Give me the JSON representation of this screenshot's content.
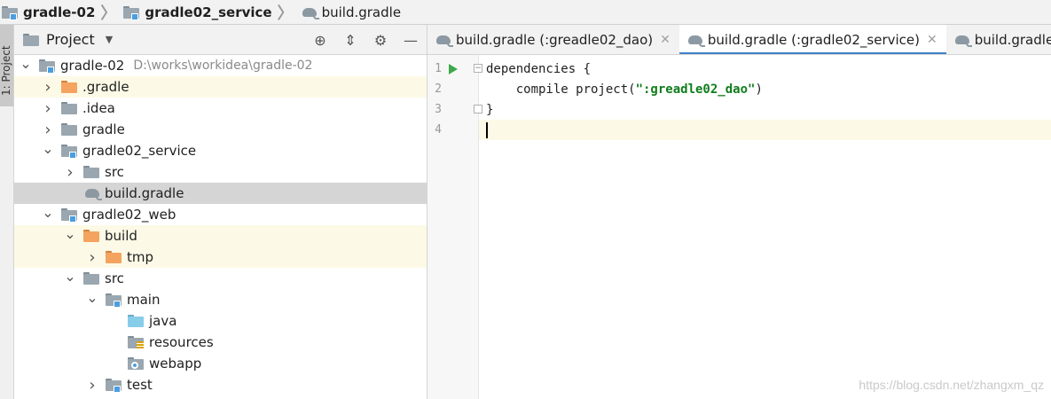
{
  "breadcrumb": {
    "items": [
      {
        "label": "gradle-02",
        "icon": "module-folder-icon",
        "bold": true
      },
      {
        "label": "gradle02_service",
        "icon": "module-folder-icon",
        "bold": true
      },
      {
        "label": "build.gradle",
        "icon": "gradle-elephant-icon",
        "bold": false
      }
    ]
  },
  "left_strip": {
    "tab_label": "1: Project"
  },
  "project_panel": {
    "title": "Project",
    "tools": [
      "locate-icon",
      "collapse-icon",
      "gear-icon",
      "minimize-icon"
    ],
    "tree": [
      {
        "label": "gradle-02",
        "hint": "D:\\works\\workidea\\gradle-02",
        "depth": 0,
        "arrow": "down",
        "icon": "module",
        "state": ""
      },
      {
        "label": ".gradle",
        "hint": "",
        "depth": 1,
        "arrow": "right",
        "icon": "orange",
        "state": "hl"
      },
      {
        "label": ".idea",
        "hint": "",
        "depth": 1,
        "arrow": "right",
        "icon": "gray",
        "state": ""
      },
      {
        "label": "gradle",
        "hint": "",
        "depth": 1,
        "arrow": "right",
        "icon": "gray",
        "state": ""
      },
      {
        "label": "gradle02_service",
        "hint": "",
        "depth": 1,
        "arrow": "down",
        "icon": "module",
        "state": ""
      },
      {
        "label": "src",
        "hint": "",
        "depth": 2,
        "arrow": "right",
        "icon": "gray",
        "state": ""
      },
      {
        "label": "build.gradle",
        "hint": "",
        "depth": 2,
        "arrow": "none",
        "icon": "elephant",
        "state": "sel"
      },
      {
        "label": "gradle02_web",
        "hint": "",
        "depth": 1,
        "arrow": "down",
        "icon": "module",
        "state": ""
      },
      {
        "label": "build",
        "hint": "",
        "depth": 2,
        "arrow": "down",
        "icon": "orange",
        "state": "hl"
      },
      {
        "label": "tmp",
        "hint": "",
        "depth": 3,
        "arrow": "right",
        "icon": "orange",
        "state": "hl"
      },
      {
        "label": "src",
        "hint": "",
        "depth": 2,
        "arrow": "down",
        "icon": "gray",
        "state": ""
      },
      {
        "label": "main",
        "hint": "",
        "depth": 3,
        "arrow": "down",
        "icon": "module",
        "state": ""
      },
      {
        "label": "java",
        "hint": "",
        "depth": 4,
        "arrow": "none",
        "icon": "blue",
        "state": ""
      },
      {
        "label": "resources",
        "hint": "",
        "depth": 4,
        "arrow": "none",
        "icon": "resources",
        "state": ""
      },
      {
        "label": "webapp",
        "hint": "",
        "depth": 4,
        "arrow": "none",
        "icon": "web",
        "state": ""
      },
      {
        "label": "test",
        "hint": "",
        "depth": 3,
        "arrow": "right",
        "icon": "module",
        "state": ""
      }
    ]
  },
  "editor": {
    "tabs": [
      {
        "label": "build.gradle (:greadle02_dao)",
        "active": false
      },
      {
        "label": "build.gradle (:gradle02_service)",
        "active": true
      },
      {
        "label": "build.gradle (:g",
        "active": false
      }
    ],
    "lines": [
      {
        "num": "1",
        "text": "dependencies {"
      },
      {
        "num": "2",
        "prefix": "    compile project(",
        "string": "\":greadle02_dao\"",
        "suffix": ")"
      },
      {
        "num": "3",
        "text": "}"
      },
      {
        "num": "4",
        "text": ""
      }
    ]
  },
  "watermark": "https://blog.csdn.net/zhangxm_qz",
  "colors": {
    "accent": "#4083c9",
    "highlight": "#fcfae6",
    "selected": "#d5d5d5",
    "string": "#107d1d"
  }
}
